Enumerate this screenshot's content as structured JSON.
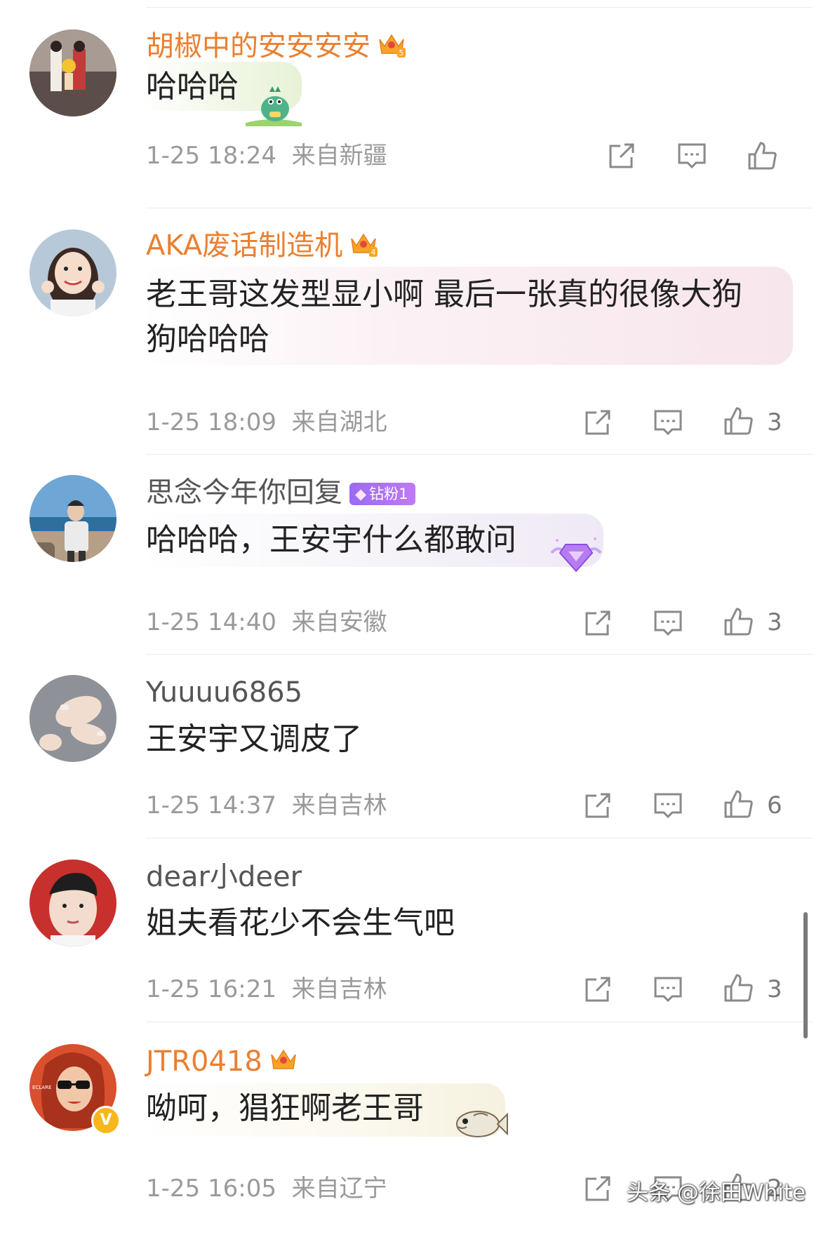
{
  "comments": [
    {
      "username": "胡椒中的安安安安",
      "crown_level": "5",
      "text": "哈哈哈",
      "time": "1-25 18:24",
      "location": "来自新疆",
      "likes": ""
    },
    {
      "username": "AKA废话制造机",
      "crown_level": "4",
      "text_line1": "老王哥这发型显小啊 最后一张真的很像大狗",
      "text_line2": "狗哈哈哈",
      "time": "1-25 18:09",
      "location": "来自湖北",
      "likes": "3"
    },
    {
      "username": "思念今年你回复",
      "badge": "钻粉1",
      "text": "哈哈哈，王安宇什么都敢问",
      "time": "1-25 14:40",
      "location": "来自安徽",
      "likes": "3"
    },
    {
      "username": "Yuuuu6865",
      "text": "王安宇又调皮了",
      "time": "1-25 14:37",
      "location": "来自吉林",
      "likes": "6"
    },
    {
      "username": "dear小deer",
      "text": "姐夫看花少不会生气吧",
      "time": "1-25 16:21",
      "location": "来自吉林",
      "likes": "3"
    },
    {
      "username": "JTR0418",
      "text": "呦呵，猖狂啊老王哥",
      "time": "1-25 16:05",
      "location": "来自辽宁",
      "likes": "2",
      "verified_mark": "V",
      "avatar_text": "ECLARE"
    }
  ],
  "watermark": "头条 @徐田White",
  "colors": {
    "vip_name": "#e98032",
    "normal_name": "#555555",
    "body_text": "#222222",
    "meta_text": "#9a9a9a",
    "icon": "#8a8a8a"
  },
  "icons": [
    "share-icon",
    "comment-icon",
    "like-icon",
    "crown-icon"
  ]
}
